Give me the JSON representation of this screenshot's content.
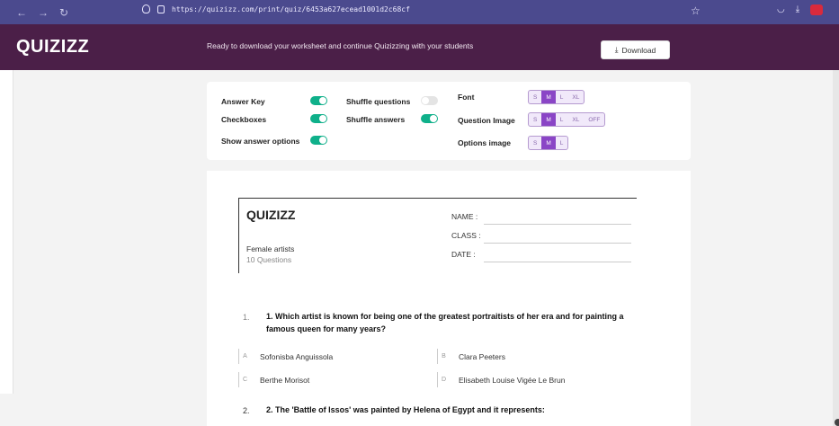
{
  "browser": {
    "url": "https://quizizz.com/print/quiz/6453a627ecead1001d2c68cf"
  },
  "header": {
    "logo": "QUIZIZZ",
    "message": "Ready to download your worksheet and continue Quizizzing with your students",
    "download_label": "Download"
  },
  "options": {
    "answer_key": {
      "label": "Answer Key",
      "on": true
    },
    "checkboxes": {
      "label": "Checkboxes",
      "on": true
    },
    "show_answer_options": {
      "label": "Show answer options",
      "on": true
    },
    "shuffle_questions": {
      "label": "Shuffle questions",
      "on": false
    },
    "shuffle_answers": {
      "label": "Shuffle answers",
      "on": true
    },
    "font": {
      "label": "Font",
      "sizes": [
        "S",
        "M",
        "L",
        "XL"
      ],
      "selected": "M"
    },
    "question_image": {
      "label": "Question Image",
      "sizes": [
        "S",
        "M",
        "L",
        "XL",
        "OFF"
      ],
      "selected": "M"
    },
    "options_image": {
      "label": "Options image",
      "sizes": [
        "S",
        "M",
        "L"
      ],
      "selected": "M"
    }
  },
  "worksheet": {
    "logo": "QUIZIZZ",
    "title": "Female artists",
    "count": "10 Questions",
    "fields": {
      "name": "NAME :",
      "class": "CLASS :",
      "date": "DATE  :"
    },
    "questions": [
      {
        "index": "1.",
        "text": "1.   Which artist is known for being one of the greatest portraitists of her era and for painting a famous queen for many years?",
        "choices": [
          {
            "letter": "A",
            "text": "Sofonisba Anguissola"
          },
          {
            "letter": "B",
            "text": "Clara Peeters"
          },
          {
            "letter": "C",
            "text": "Berthe Morisot"
          },
          {
            "letter": "D",
            "text": "Elisabeth Louise Vigée Le Brun"
          }
        ]
      },
      {
        "index": "2.",
        "text": "2.   The 'Battle of Issos' was painted by Helena of Egypt and it represents:"
      }
    ]
  },
  "colors": {
    "browser_bar": "#4b4a8e",
    "header": "#4b1f48",
    "toggle_on": "#0fb08a",
    "size_active": "#8a45c6"
  }
}
